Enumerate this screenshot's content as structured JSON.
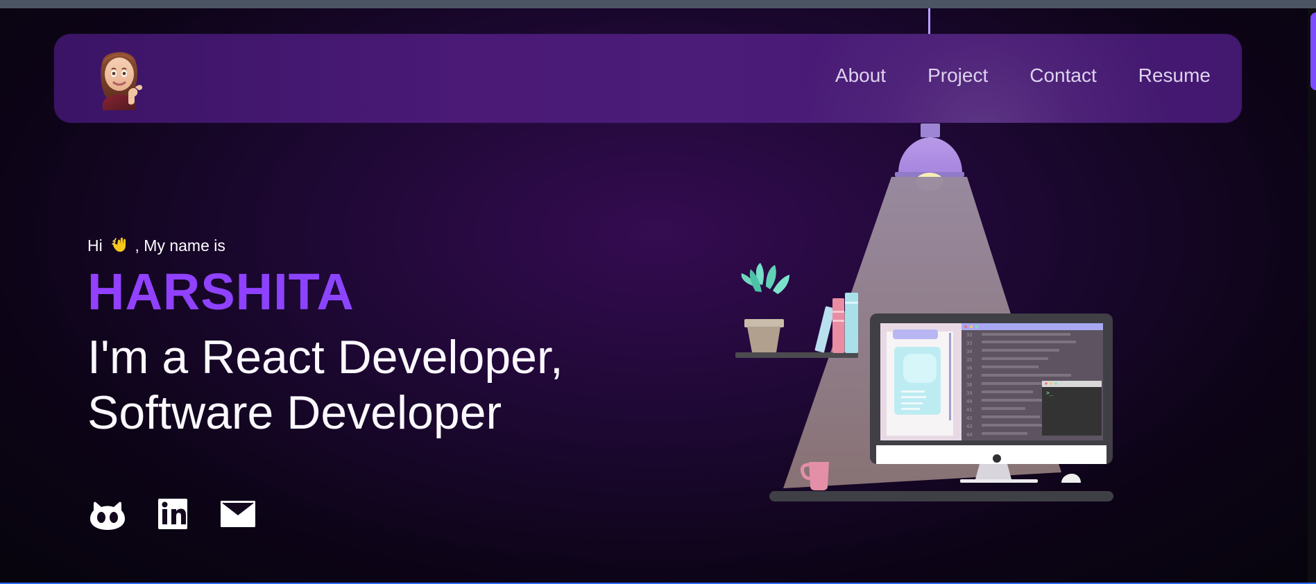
{
  "browser": {
    "top_strip_color": "#4b5563",
    "right_thumb_color": "#7c4dff",
    "bottom_line_color": "#2f6cff"
  },
  "nav": {
    "links": [
      "About",
      "Project",
      "Contact",
      "Resume"
    ],
    "logo_icon": "memoji-thumbs-up-icon"
  },
  "hero": {
    "greeting": "Hi",
    "greeting_suffix": ", My name is",
    "wave_icon": "waving-hand-icon",
    "name": "HARSHITA",
    "line1": "I'm a React Developer,",
    "line2": "Software Developer"
  },
  "socials": [
    {
      "icon": "github-icon"
    },
    {
      "icon": "linkedin-icon"
    },
    {
      "icon": "mail-icon"
    }
  ],
  "colors": {
    "background": "#07040d",
    "nav_background": "#4a1a76",
    "nav_text": "#ded3ef",
    "accent": "#8a44ff",
    "accent_end": "#6d5cf8",
    "text": "#ffffff"
  },
  "illustration": {
    "lamp": "ceiling-lamp-icon",
    "desk": "desk-scene",
    "plant": "potted-plant-icon",
    "books": "books-icon",
    "monitor": "monitor-code-editor-icon",
    "mug": "mug-icon",
    "mouse": "mouse-icon",
    "code_line_numbers": [
      "32",
      "33",
      "34",
      "35",
      "36",
      "37",
      "38",
      "39",
      "40",
      "41",
      "42",
      "43",
      "44"
    ]
  }
}
